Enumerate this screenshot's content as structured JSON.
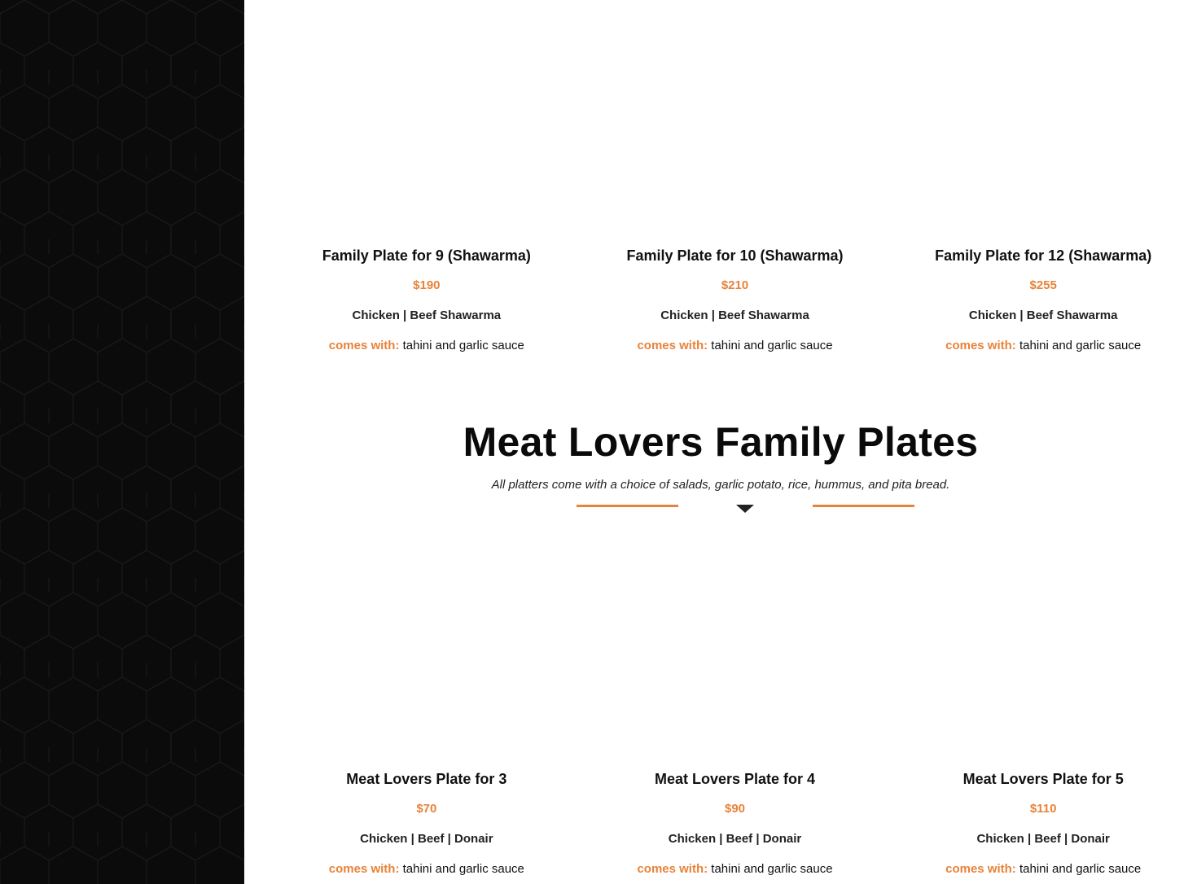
{
  "colors": {
    "accent": "#e8833a",
    "sidebar_bg": "#0b0b0b",
    "text": "#111111"
  },
  "shawarma_plates": [
    {
      "title": "Family Plate for 9 (Shawarma)",
      "price": "$190",
      "meats": "Chicken | Beef Shawarma",
      "comes_label": "comes with:",
      "comes_value": "tahini and garlic sauce"
    },
    {
      "title": "Family Plate for 10 (Shawarma)",
      "price": "$210",
      "meats": "Chicken | Beef Shawarma",
      "comes_label": "comes with:",
      "comes_value": "tahini and garlic sauce"
    },
    {
      "title": "Family Plate for 12 (Shawarma)",
      "price": "$255",
      "meats": "Chicken | Beef Shawarma",
      "comes_label": "comes with:",
      "comes_value": "tahini and garlic sauce"
    }
  ],
  "meat_lovers_section": {
    "title": "Meat Lovers Family Plates",
    "subtitle": "All platters come with a choice of salads, garlic potato, rice, hummus, and pita bread."
  },
  "meat_lovers_plates": [
    {
      "title": "Meat Lovers Plate for 3",
      "price": "$70",
      "meats": "Chicken | Beef | Donair",
      "comes_label": "comes with:",
      "comes_value": "tahini and garlic sauce"
    },
    {
      "title": "Meat Lovers Plate for 4",
      "price": "$90",
      "meats": "Chicken | Beef | Donair",
      "comes_label": "comes with:",
      "comes_value": "tahini and garlic sauce"
    },
    {
      "title": "Meat Lovers Plate for 5",
      "price": "$110",
      "meats": "Chicken | Beef | Donair",
      "comes_label": "comes with:",
      "comes_value": "tahini and garlic sauce"
    }
  ]
}
